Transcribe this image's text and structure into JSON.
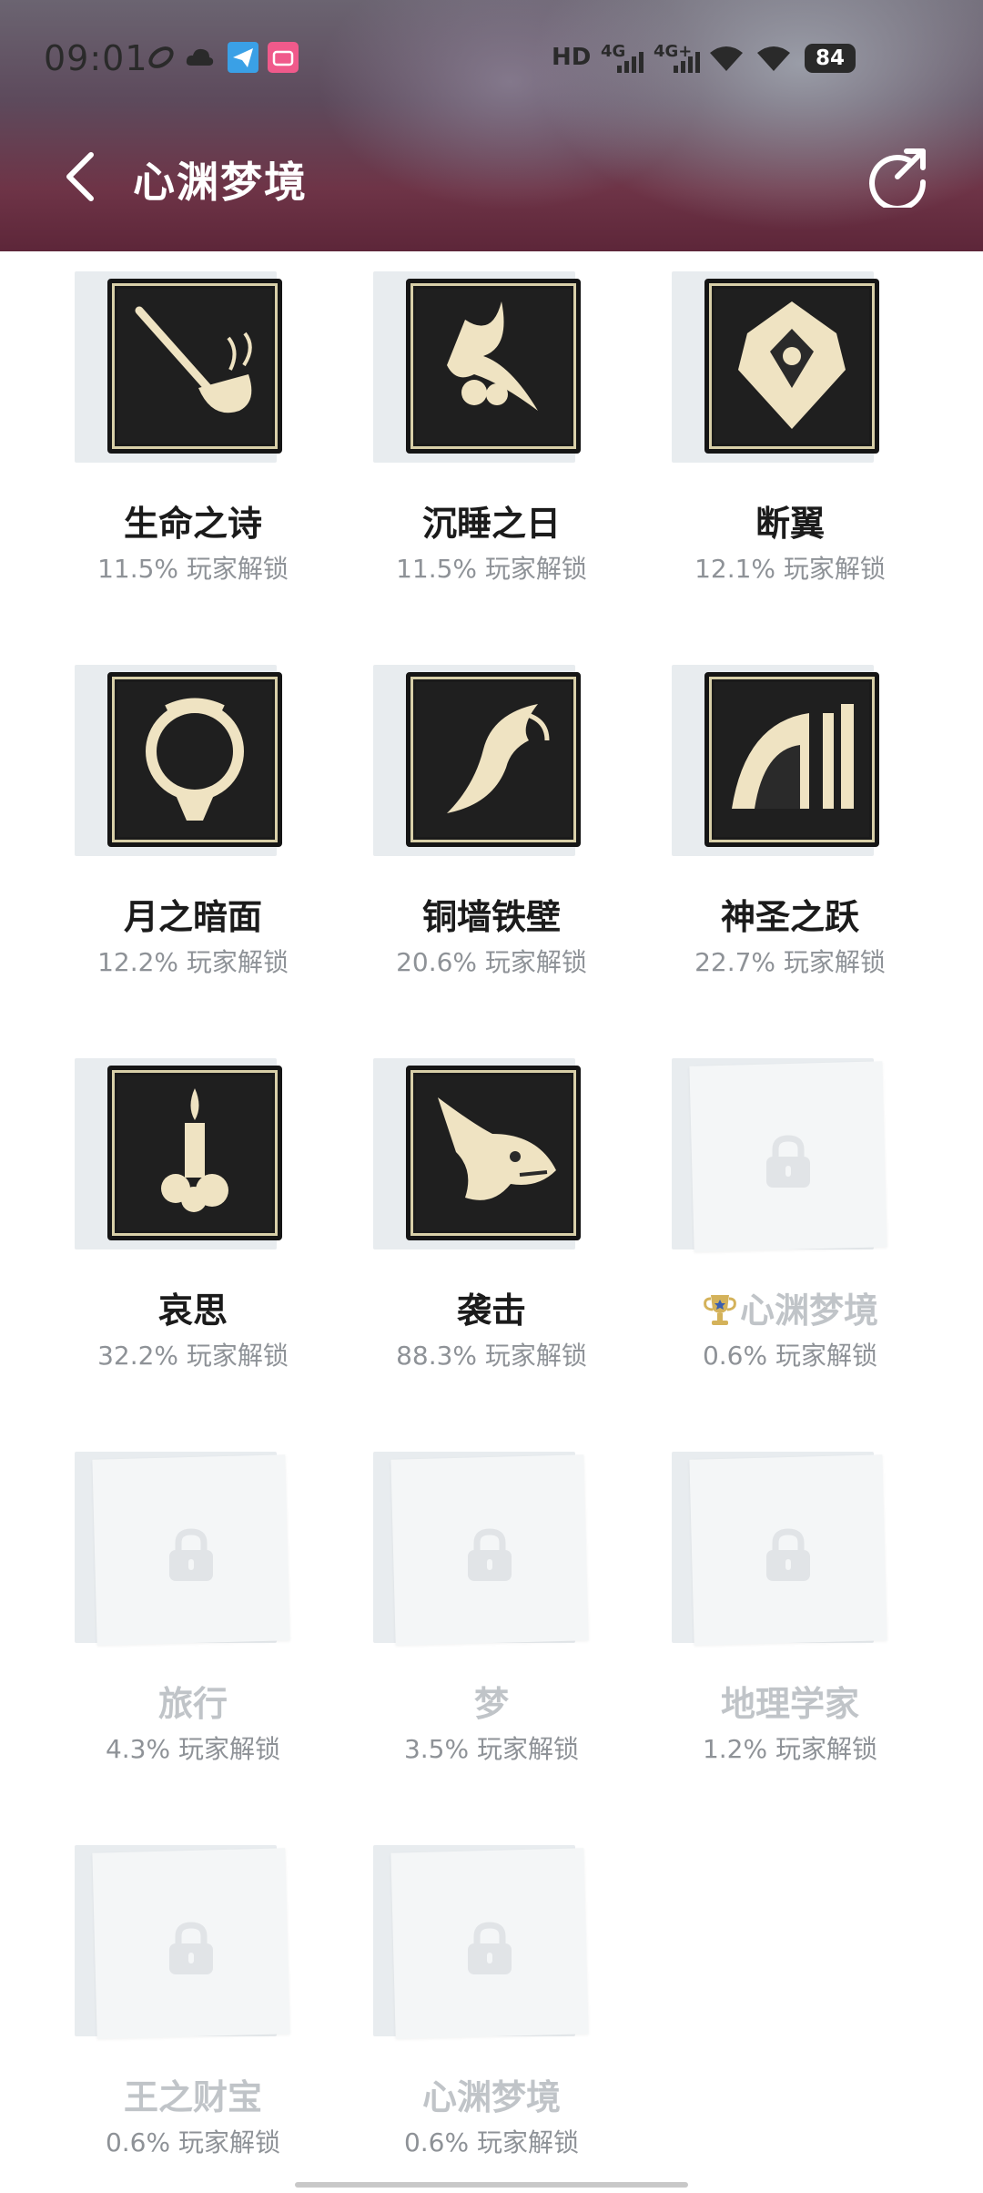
{
  "status_bar": {
    "time": "09:01",
    "network": "HD",
    "sim1": "4G",
    "sim2": "4G+",
    "battery": "84"
  },
  "header": {
    "title": "心渊梦境"
  },
  "achievements": [
    {
      "name": "生命之诗",
      "percent": "11.5% 玩家解锁",
      "unlocked": true,
      "icon": "pipe-icon"
    },
    {
      "name": "沉睡之日",
      "percent": "11.5% 玩家解锁",
      "unlocked": true,
      "icon": "bird-rose-icon"
    },
    {
      "name": "断翼",
      "percent": "12.1% 玩家解锁",
      "unlocked": true,
      "icon": "crest-icon"
    },
    {
      "name": "月之暗面",
      "percent": "12.2% 玩家解锁",
      "unlocked": true,
      "icon": "moon-ring-icon"
    },
    {
      "name": "铜墙铁壁",
      "percent": "20.6% 玩家解锁",
      "unlocked": true,
      "icon": "dragon-icon"
    },
    {
      "name": "神圣之跃",
      "percent": "22.7% 玩家解锁",
      "unlocked": true,
      "icon": "ruins-icon"
    },
    {
      "name": "哀思",
      "percent": "32.2% 玩家解锁",
      "unlocked": true,
      "icon": "candle-icon"
    },
    {
      "name": "袭击",
      "percent": "88.3% 玩家解锁",
      "unlocked": true,
      "icon": "beast-head-icon"
    },
    {
      "name": "心渊梦境",
      "percent": "0.6% 玩家解锁",
      "unlocked": false,
      "trophy": true
    },
    {
      "name": "旅行",
      "percent": "4.3% 玩家解锁",
      "unlocked": false
    },
    {
      "name": "梦",
      "percent": "3.5% 玩家解锁",
      "unlocked": false
    },
    {
      "name": "地理学家",
      "percent": "1.2% 玩家解锁",
      "unlocked": false
    },
    {
      "name": "王之财宝",
      "percent": "0.6% 玩家解锁",
      "unlocked": false
    },
    {
      "name": "心渊梦境",
      "percent": "0.6% 玩家解锁",
      "unlocked": false
    }
  ]
}
